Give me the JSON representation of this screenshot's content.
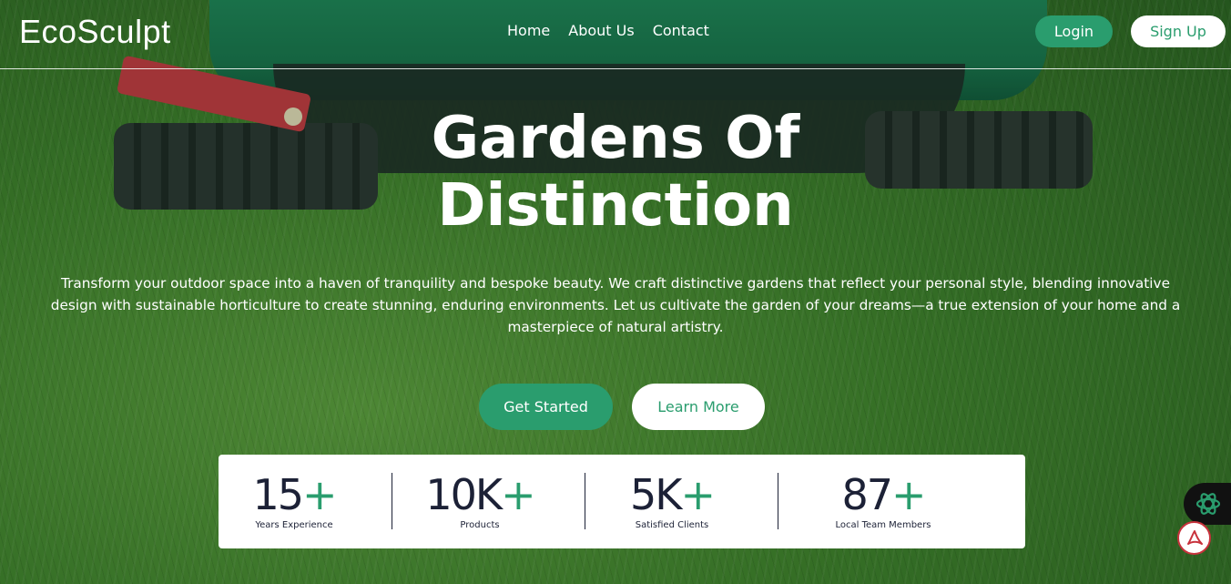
{
  "brand": {
    "logo": "EcoSculpt"
  },
  "nav": {
    "links": [
      "Home",
      "About Us",
      "Contact"
    ],
    "login_label": "Login",
    "signup_label": "Sign Up"
  },
  "hero": {
    "title_line1": "Gardens Of",
    "title_line2": "Distinction",
    "description": "Transform your outdoor space into a haven of tranquility and bespoke beauty. We craft distinctive gardens that reflect your personal style, blending innovative design with sustainable horticulture to create stunning, enduring environments. Let us cultivate the garden of your dreams—a true extension of your home and a masterpiece of natural artistry.",
    "primary_cta": "Get Started",
    "secondary_cta": "Learn More"
  },
  "stats": [
    {
      "value": "15",
      "plus": "+",
      "label": "Years Experience"
    },
    {
      "value": "10K",
      "plus": "+",
      "label": "Products"
    },
    {
      "value": "5K",
      "plus": "+",
      "label": "Satisfied Clients"
    },
    {
      "value": "87",
      "plus": "+",
      "label": "Local Team Members"
    }
  ],
  "colors": {
    "accent": "#2a9d6e",
    "text_dark": "#1c2136",
    "white": "#ffffff"
  },
  "icons": {
    "ai_widget": "ai-assistant-icon",
    "pdf_widget": "pdf-icon"
  }
}
